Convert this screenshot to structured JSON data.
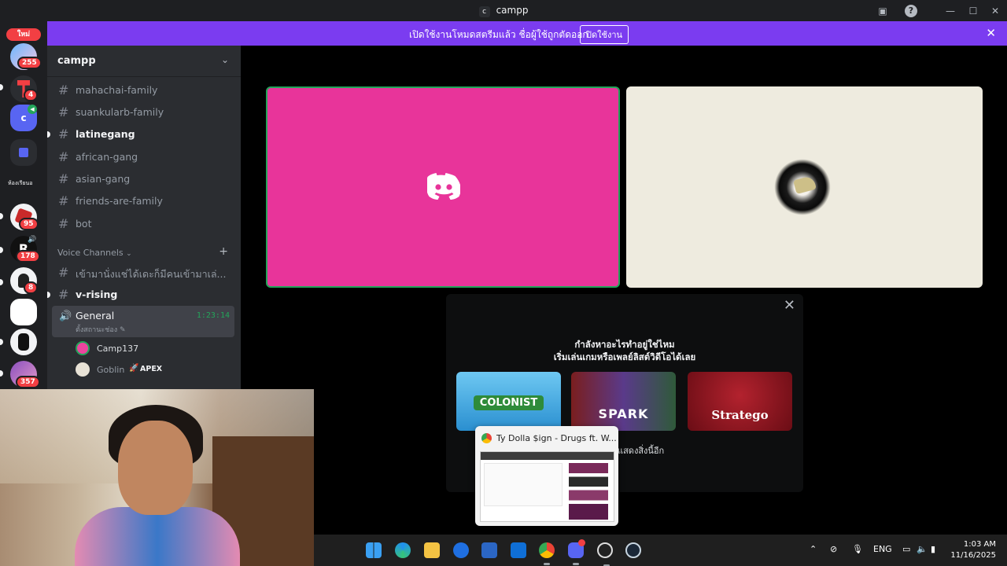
{
  "window": {
    "title": "campp",
    "badge": "c"
  },
  "notice": {
    "message": "เปิดใช้งานโหมดสตรีมแล้ว ชื่อผู้ใช้ถูกตัดออก",
    "button": "ปิดใช้งาน",
    "close": "✕"
  },
  "rail": {
    "new_label": "ใหม่",
    "folder_label": "ห้องเรียนอ",
    "badges": [
      "255",
      "4",
      "95",
      "178",
      "8",
      "357"
    ],
    "active_server_letter": "c"
  },
  "server": {
    "name": "campp",
    "chevron": "⌄"
  },
  "channels": [
    {
      "name": "mahachai-family"
    },
    {
      "name": "suankularb-family"
    },
    {
      "name": "latinegang"
    },
    {
      "name": "african-gang"
    },
    {
      "name": "asian-gang"
    },
    {
      "name": "friends-are-family"
    },
    {
      "name": "bot"
    }
  ],
  "voice_category": {
    "label": "Voice Channels",
    "add": "+"
  },
  "voice_channels": [
    {
      "name": "เข้ามานั่งแช่ได้เดะก็มีคนเข้ามาเล่..."
    },
    {
      "name": "v-rising"
    }
  ],
  "active_voice": {
    "name": "General",
    "time": "1:23:14",
    "status": "ตั้งสถานะช่อง ✎"
  },
  "voice_users": [
    {
      "name": "Camp137"
    },
    {
      "name": "Goblin",
      "tag": "APEX"
    }
  ],
  "activity": {
    "line1": "กำลังหาอะไรทำอยู่ใช่ไหม",
    "line2": "เริ่มเล่นเกมหรือเพลย์ลิสต์วิดีโอได้เลย",
    "games": [
      {
        "name": "COLONIST",
        "color": "#3aa7e0"
      },
      {
        "name": "SPARK",
        "color": "#8a2a2a"
      },
      {
        "name": "Stratego",
        "color": "#9a1420"
      }
    ],
    "more": "แสดงสิ่งนี้อีก"
  },
  "preview": {
    "title": "Ty Dolla $ign - Drugs ft. W..."
  },
  "taskbar": {
    "lang": "ENG",
    "time": "1:03 AM",
    "date": "11/16/2025"
  },
  "colors": {
    "accent": "#7b3cf0",
    "speaking": "#23a55a",
    "tile_pink": "#e8349a"
  }
}
